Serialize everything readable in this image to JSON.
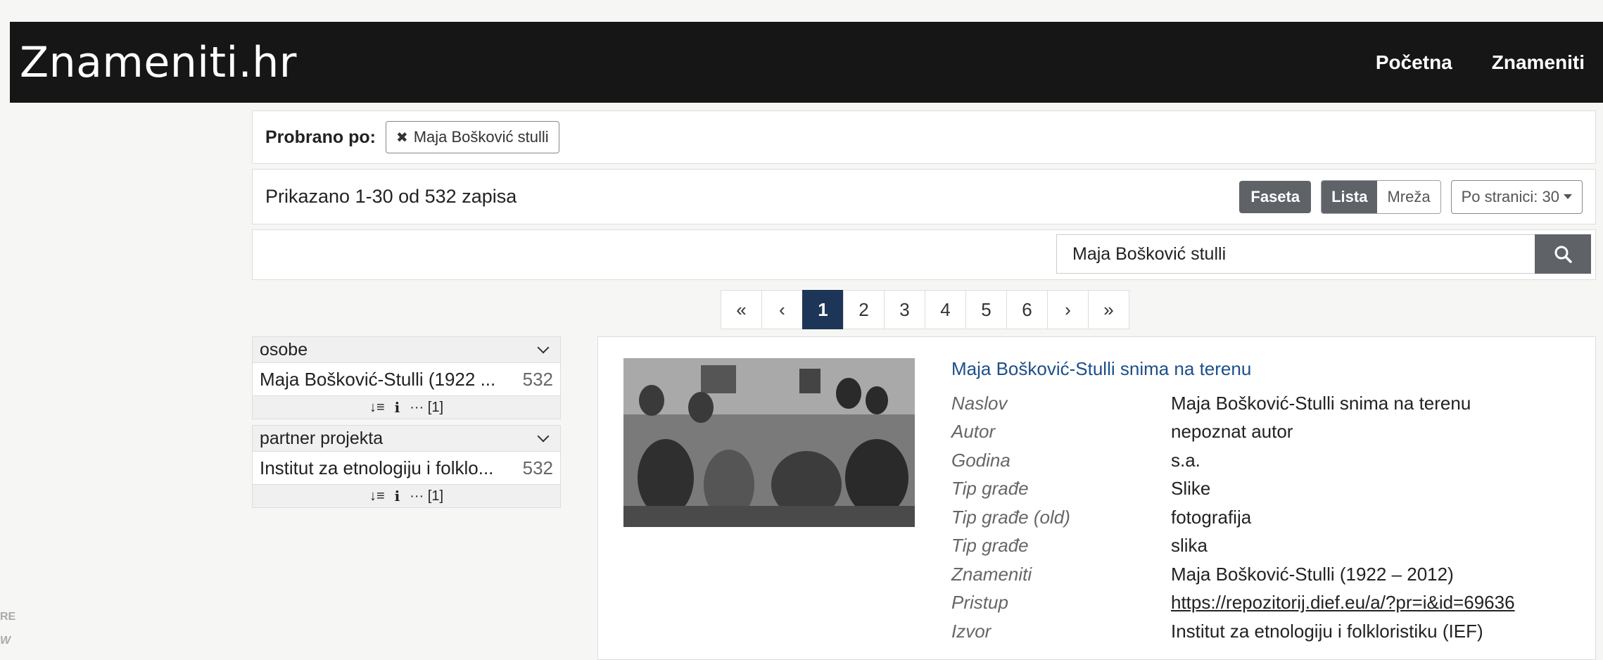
{
  "nav": {
    "brand": "Znameniti.hr",
    "links": [
      "Početna",
      "Znameniti"
    ]
  },
  "filter": {
    "label": "Probrano po:",
    "chip": "Maja Bošković stulli"
  },
  "results_bar": {
    "count_text": "Prikazano 1-30 od 532 zapisa",
    "faceta": "Faseta",
    "lista": "Lista",
    "mreza": "Mreža",
    "per_page": "Po stranici: 30"
  },
  "search": {
    "value": "Maja Bošković stulli"
  },
  "pagination": {
    "first": "«",
    "prev": "‹",
    "pages": [
      "1",
      "2",
      "3",
      "4",
      "5",
      "6"
    ],
    "next": "›",
    "last": "»",
    "current": "1"
  },
  "facets": [
    {
      "title": "osobe",
      "item": "Maja Bošković-Stulli (1922 ...",
      "count": "532",
      "more": "[1]"
    },
    {
      "title": "partner projekta",
      "item": "Institut za etnologiju i folklo...",
      "count": "532",
      "more": "[1]"
    }
  ],
  "result": {
    "title": "Maja Bošković-Stulli snima na terenu",
    "fields": [
      {
        "k": "Naslov",
        "v": "Maja Bošković-Stulli snima na terenu"
      },
      {
        "k": "Autor",
        "v": "nepoznat autor"
      },
      {
        "k": "Godina",
        "v": "s.a."
      },
      {
        "k": "Tip građe",
        "v": "Slike"
      },
      {
        "k": "Tip građe (old)",
        "v": "fotografija"
      },
      {
        "k": "Tip građe",
        "v": "slika"
      },
      {
        "k": "Znameniti",
        "v": "Maja Bošković-Stulli (1922 – 2012)"
      },
      {
        "k": "Pristup",
        "v": "https://repozitorij.dief.eu/a/?pr=i&id=69636"
      },
      {
        "k": "Izvor",
        "v": "Institut za etnologiju i folkloristiku (IEF)"
      }
    ]
  },
  "edge_text": {
    "a": "RE",
    "b": "W"
  }
}
